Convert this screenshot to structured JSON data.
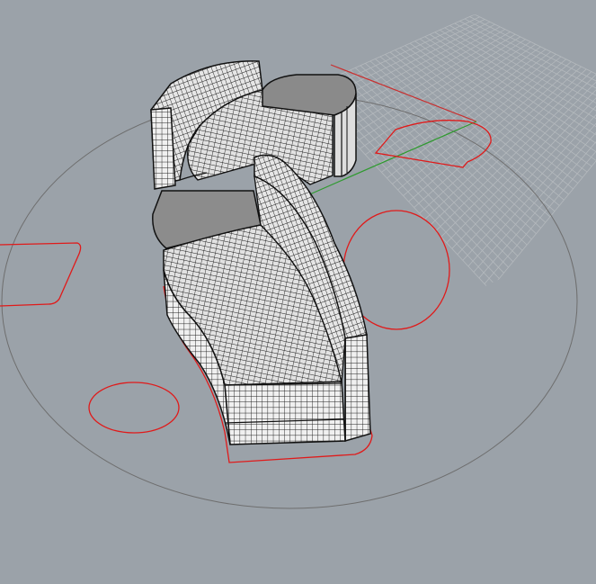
{
  "viewport": {
    "background_color": "#9ba2a9",
    "grid_color": "#b4b9bd",
    "axis_x_color": "#c83030",
    "axis_y_color": "#2f9a2f",
    "curve_color": "#e01a1a",
    "mesh_line_color": "#1a1a1a",
    "surface_light_color": "#e8e8e8",
    "surface_dark_color": "#7d7d7d",
    "boundary_circle_color": "#6e6e6e"
  }
}
